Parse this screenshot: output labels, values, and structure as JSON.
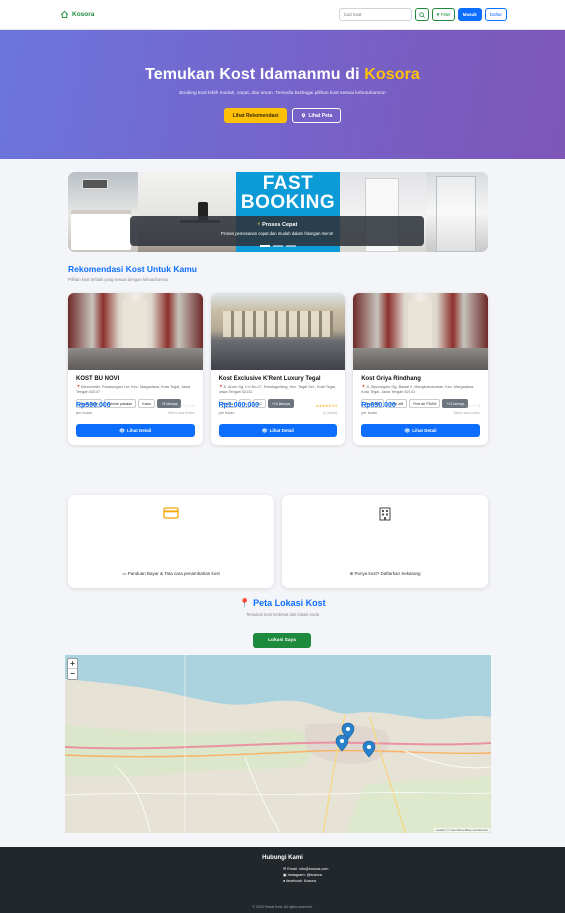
{
  "navbar": {
    "brand": "Kosora",
    "search_placeholder": "Cari kost",
    "filter_label": "Filter",
    "login_label": "Masuk",
    "register_label": "Daftar"
  },
  "hero": {
    "title_prefix": "Temukan Kost Idamanmu di ",
    "title_accent": "Kosora",
    "subtitle": "Booking kost lebih mudah, cepat, dan aman. Tersedia berbagai pilihan kost sesuai kebutuhanmu!",
    "primary_button": "Lihat Rekomendasi",
    "secondary_button": "Lihat Peta"
  },
  "carousel": {
    "banner_line1": "FAST",
    "banner_line2": "BOOKING",
    "caption_title": "Proses Cepat",
    "caption_text": "Proses pemesanan cepat dan mudah dalam hitungan menit!"
  },
  "recommendations": {
    "title": "Rekomendasi Kost Untuk Kamu",
    "subtitle": "Pilihan kost terbaik yang sesuai dengan kebutuhanmu",
    "detail_label": "Lihat Detail",
    "cards": [
      {
        "name": "KOST BU NOVI",
        "address": "Kebonmiter, Panarungan Lor, Kec. Margadana, Kota Tegal, Jawa Tengah 52147",
        "tags": [
          "Kipas angin",
          "Lemari pakaian",
          "Kasur",
          "+8 lainnya"
        ],
        "price": "Rp500.000",
        "period": "per bulan",
        "rating": "☆☆☆☆☆ 0",
        "rating_note": "Belum ada review"
      },
      {
        "name": "Kost Exclusive K'Rent Luxury Tegal",
        "address": "Jl. Arum Gg. II Ir.No.27, Randugunting, Kec. Tegal Sel., Kota Tegal, Jawa Tengah 52131",
        "tags": [
          "Kulkas",
          "Tv",
          "AC",
          "+10 lainnya"
        ],
        "price": "Rp1.000.000",
        "period": "per bulan",
        "rating": "★★★★★ 5.0",
        "rating_note": "(1 review)"
      },
      {
        "name": "Kost Griya Rindhang",
        "address": "Jl. Diponegoro Gg. Bawal 2, Mangkukusuman, Kec. Margadana, Kota Tegal, Jawa Tengah 52141",
        "tags": [
          "Air bersih",
          "Free wifi",
          "Free air PDAM",
          "+13 lainnya"
        ],
        "price": "Rp650.000",
        "period": "per bulan",
        "rating": "☆☆☆☆☆ 0",
        "rating_note": "Belum ada review"
      }
    ]
  },
  "info": {
    "left_text": "Panduan Bayar & Tata cara penambahan kost",
    "right_text": "Punya kost? Daftarkan Sekarang"
  },
  "map_section": {
    "title": "Peta Lokasi Kost",
    "subtitle": "Temukan kost terdekat dari lokasi Anda",
    "locate_button": "Lokasi Saya",
    "zoom_in": "+",
    "zoom_out": "−",
    "attribution": "Leaflet | © OpenStreetMap contributors"
  },
  "footer": {
    "heading": "Hubungi Kami",
    "email": "Email: info@kosora.com",
    "instagram": "Instagram: @kosora",
    "facebook": "facebook: Kosora",
    "copyright": "© 2025 Sewal Kost. All rights reserved."
  },
  "colors": {
    "brand_green": "#1d8a3e",
    "primary_blue": "#0d6efd",
    "accent_yellow": "#ffc107",
    "hero_start": "#6b76dd",
    "hero_end": "#7e56b8",
    "footer_bg": "#22272c"
  }
}
